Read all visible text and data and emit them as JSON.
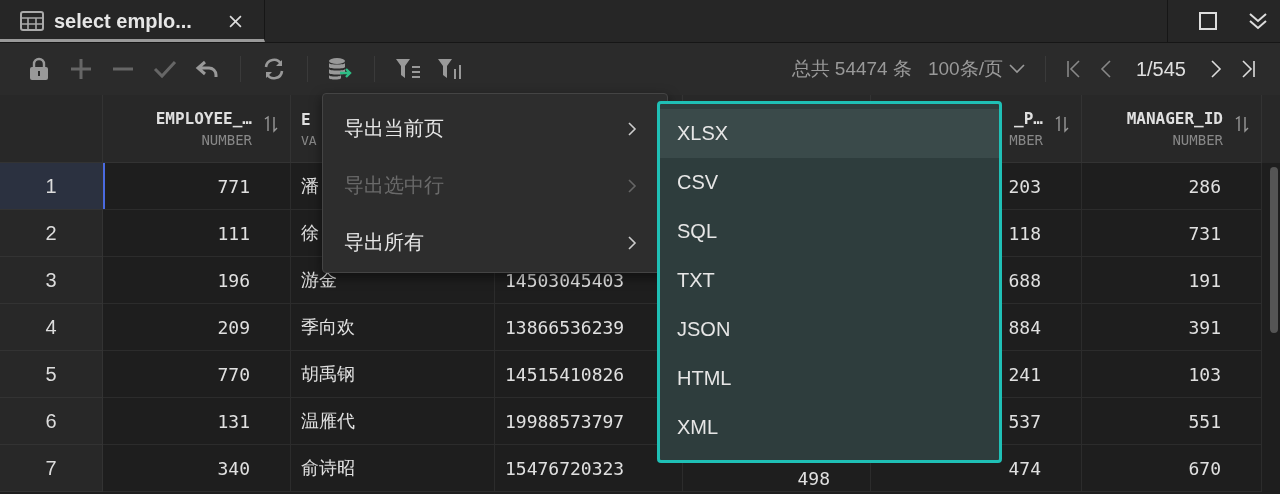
{
  "tabs": [
    {
      "label": "select emplo...",
      "selected": true
    }
  ],
  "pagination": {
    "total": "总共 54474 条",
    "page_size": "100条/页",
    "page": "1/545"
  },
  "columns": [
    {
      "header": "EMPLOYEE_…",
      "type": "NUMBER",
      "kind": "number"
    },
    {
      "header": "E",
      "type": "VA",
      "kind": "text"
    },
    {
      "kind": "text"
    },
    {
      "kind": "number"
    },
    {
      "header": "_P…",
      "type": "MBER",
      "kind": "number"
    },
    {
      "header": "MANAGER_ID",
      "type": "NUMBER",
      "kind": "number"
    }
  ],
  "rows": [
    {
      "num": "1",
      "selected": true,
      "cells": [
        "771",
        "潘",
        null,
        null,
        "203",
        "286"
      ]
    },
    {
      "num": "2",
      "selected": false,
      "cells": [
        "111",
        "徐",
        null,
        null,
        "118",
        "731"
      ]
    },
    {
      "num": "3",
      "selected": false,
      "cells": [
        "196",
        "游金",
        "14503045403",
        null,
        "688",
        "191"
      ]
    },
    {
      "num": "4",
      "selected": false,
      "cells": [
        "209",
        "季向欢",
        "13866536239",
        null,
        "884",
        "391"
      ]
    },
    {
      "num": "5",
      "selected": false,
      "cells": [
        "770",
        "胡禹钢",
        "14515410826",
        null,
        "241",
        "103"
      ]
    },
    {
      "num": "6",
      "selected": false,
      "cells": [
        "131",
        "温雁代",
        "19988573797",
        null,
        "537",
        "551"
      ]
    },
    {
      "num": "7",
      "selected": false,
      "cells": [
        "340",
        "俞诗昭",
        "15476720323",
        "498",
        "474",
        "670"
      ]
    }
  ],
  "menu": [
    {
      "label": "导出当前页",
      "disabled": false
    },
    {
      "label": "导出选中行",
      "disabled": true
    },
    {
      "label": "导出所有",
      "disabled": false
    }
  ],
  "submenu": [
    {
      "label": "XLSX",
      "selected": true
    },
    {
      "label": "CSV",
      "selected": false
    },
    {
      "label": "SQL",
      "selected": false
    },
    {
      "label": "TXT",
      "selected": false
    },
    {
      "label": "JSON",
      "selected": false
    },
    {
      "label": "HTML",
      "selected": false
    },
    {
      "label": "XML",
      "selected": false
    }
  ]
}
